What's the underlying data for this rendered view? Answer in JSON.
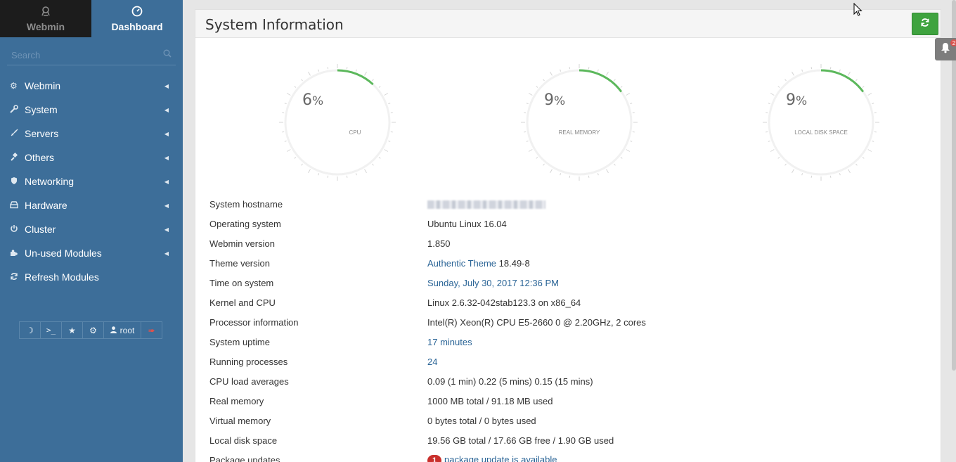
{
  "nav": {
    "webmin_tab": "Webmin",
    "dashboard_tab": "Dashboard"
  },
  "search": {
    "placeholder": "Search"
  },
  "menu": [
    {
      "label": "Webmin",
      "icon": "gear-icon"
    },
    {
      "label": "System",
      "icon": "wrench-icon"
    },
    {
      "label": "Servers",
      "icon": "rocket-icon"
    },
    {
      "label": "Others",
      "icon": "gavel-icon"
    },
    {
      "label": "Networking",
      "icon": "shield-icon"
    },
    {
      "label": "Hardware",
      "icon": "hdd-icon"
    },
    {
      "label": "Cluster",
      "icon": "power-icon"
    },
    {
      "label": "Un-used Modules",
      "icon": "puzzle-icon"
    },
    {
      "label": "Refresh Modules",
      "icon": "refresh-icon"
    }
  ],
  "toolbar": {
    "user": "root"
  },
  "panel": {
    "title": "System Information"
  },
  "gauges": [
    {
      "value": 6,
      "unit": "%",
      "label": "CPU"
    },
    {
      "value": 9,
      "unit": "%",
      "label": "REAL MEMORY"
    },
    {
      "value": 9,
      "unit": "%",
      "label": "LOCAL DISK SPACE"
    }
  ],
  "info": {
    "hostname_label": "System hostname",
    "os_label": "Operating system",
    "os": "Ubuntu Linux 16.04",
    "webmin_label": "Webmin version",
    "webmin": "1.850",
    "theme_label": "Theme version",
    "theme_link": "Authentic Theme",
    "theme_ver": "18.49-8",
    "time_label": "Time on system",
    "time": "Sunday, July 30, 2017 12:36 PM",
    "kernel_label": "Kernel and CPU",
    "kernel": "Linux 2.6.32-042stab123.3 on x86_64",
    "proc_label": "Processor information",
    "proc": "Intel(R) Xeon(R) CPU E5-2660 0 @ 2.20GHz, 2 cores",
    "uptime_label": "System uptime",
    "uptime": "17 minutes",
    "procs_label": "Running processes",
    "procs": "24",
    "load_label": "CPU load averages",
    "load": "0.09 (1 min) 0.22 (5 mins) 0.15 (15 mins)",
    "mem_label": "Real memory",
    "mem": "1000 MB total / 91.18 MB used",
    "vmem_label": "Virtual memory",
    "vmem": "0 bytes total / 0 bytes used",
    "disk_label": "Local disk space",
    "disk": "19.56 GB total / 17.66 GB free / 1.90 GB used",
    "pkg_label": "Package updates",
    "pkg_count": "1",
    "pkg": "package update is available"
  },
  "notifications": {
    "count": "2"
  },
  "colors": {
    "sidebar": "#3d6e99",
    "accent_green": "#3fa33f",
    "link": "#2a6496",
    "gauge": "#5cb85c"
  }
}
